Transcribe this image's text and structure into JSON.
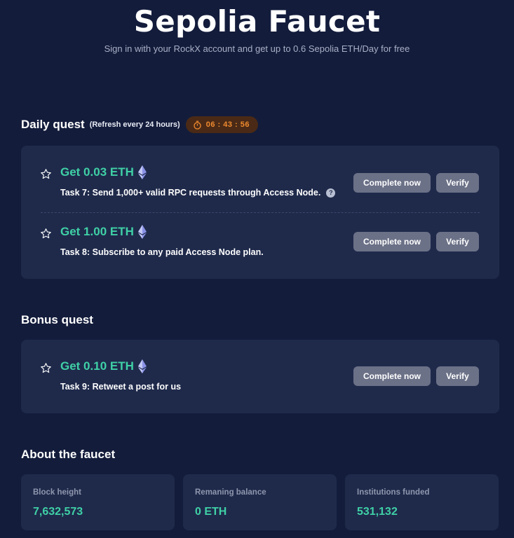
{
  "header": {
    "title": "Sepolia Faucet",
    "subtitle": "Sign in with your RockX account and get up to 0.6 Sepolia ETH/Day for free"
  },
  "daily": {
    "title": "Daily quest",
    "note": "(Refresh every 24 hours)",
    "timer": "06 : 43 : 56",
    "timer_color": "#f08a2e",
    "quests": [
      {
        "reward": "Get 0.03 ETH",
        "task": "Task 7: Send 1,000+ valid RPC requests through Access Node.",
        "complete_label": "Complete now",
        "verify_label": "Verify"
      },
      {
        "reward": "Get 1.00 ETH",
        "task": "Task 8: Subscribe to any paid Access Node plan.",
        "complete_label": "Complete now",
        "verify_label": "Verify"
      }
    ]
  },
  "bonus": {
    "title": "Bonus quest",
    "quests": [
      {
        "reward": "Get 0.10 ETH",
        "task": "Task 9: Retweet a post for us",
        "complete_label": "Complete now",
        "verify_label": "Verify"
      }
    ]
  },
  "about": {
    "title": "About the faucet",
    "stats": [
      {
        "label": "Block height",
        "value": "7,632,573"
      },
      {
        "label": "Remaning balance",
        "value": "0 ETH"
      },
      {
        "label": "Institutions funded",
        "value": "531,132"
      }
    ]
  },
  "colors": {
    "background": "#131c3b",
    "card": "#1f2a4b",
    "accent_green": "#3fd0a6",
    "button": "#6b7187"
  },
  "icons": {
    "star": "star-outline-icon",
    "eth": "ethereum-icon",
    "help": "question-circle-icon",
    "timer": "stopwatch-icon"
  }
}
